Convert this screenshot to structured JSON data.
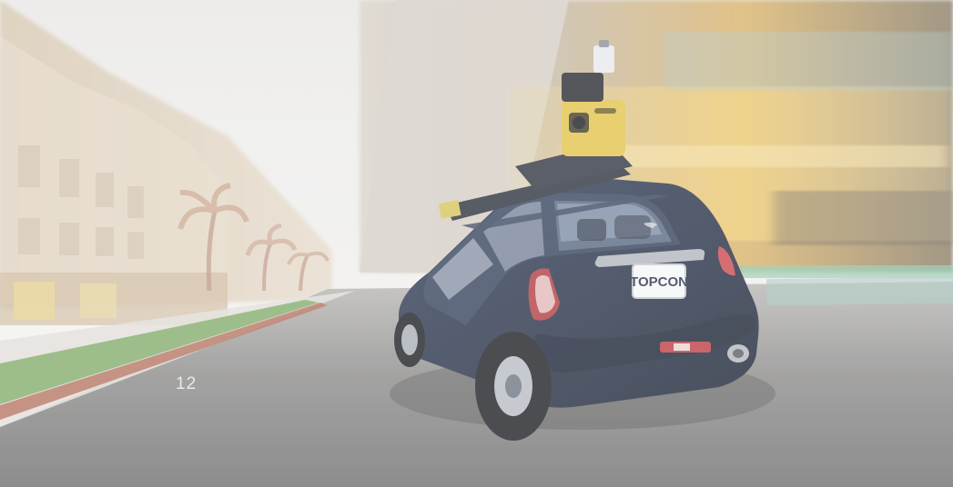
{
  "slide": {
    "page_number": "12",
    "license_plate": "TOPCON"
  },
  "colors": {
    "sky": "#efeeec",
    "road": "#7f7f7e",
    "car_body": "#243047",
    "scanner_yellow": "#e2c54c",
    "curb_red": "#b36c58",
    "grass": "#7aa85f"
  },
  "scene_objects": [
    "left-building",
    "right-building",
    "road",
    "mini-cooper-car",
    "roof-mounted-scanner",
    "palm-trees"
  ]
}
